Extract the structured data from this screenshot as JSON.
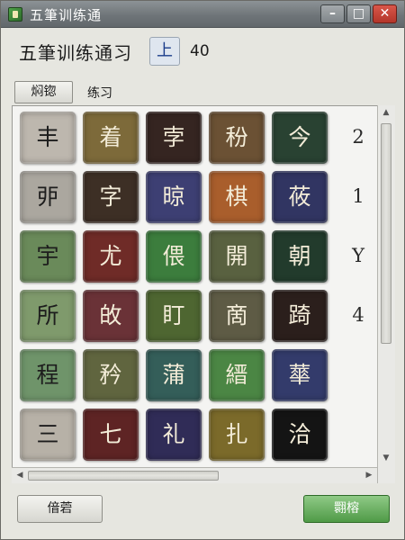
{
  "window": {
    "title": "五筆训练通",
    "controls": {
      "minimize": "–",
      "maximize": "□",
      "close": "✕"
    }
  },
  "header": {
    "app_title": "五筆训练通习",
    "level": "上",
    "score": "40"
  },
  "toolbar": {
    "tab_button": "焖锪",
    "tab_label": "练习"
  },
  "grid": {
    "rows": [
      {
        "tiles": [
          {
            "char": "丰",
            "bg": "#bdb7ae",
            "fg": "#1d1d1d"
          },
          {
            "char": "着",
            "bg": "#7d6a3a",
            "fg": "#f3ecd8"
          },
          {
            "char": "孛",
            "bg": "#352521",
            "fg": "#f3ecd8"
          },
          {
            "char": "秎",
            "bg": "#6b5134",
            "fg": "#f3ecd8"
          },
          {
            "char": "今",
            "bg": "#294232",
            "fg": "#f3ecd8"
          }
        ],
        "side": "2"
      },
      {
        "tiles": [
          {
            "char": "戼",
            "bg": "#aba79f",
            "fg": "#1d1d1d"
          },
          {
            "char": "字",
            "bg": "#3d2f25",
            "fg": "#f3ecd8"
          },
          {
            "char": "晾",
            "bg": "#3d3f73",
            "fg": "#f3ecd8"
          },
          {
            "char": "棋",
            "bg": "#a95e2c",
            "fg": "#f3ecd8"
          },
          {
            "char": "莜",
            "bg": "#313562",
            "fg": "#f3ecd8"
          }
        ],
        "side": "1"
      },
      {
        "tiles": [
          {
            "char": "宇",
            "bg": "#6a8a5a",
            "fg": "#1d1d1d"
          },
          {
            "char": "尤",
            "bg": "#6f2b27",
            "fg": "#f3ecd8"
          },
          {
            "char": "偎",
            "bg": "#3c7d3d",
            "fg": "#f3ecd8"
          },
          {
            "char": "開",
            "bg": "#596140",
            "fg": "#f3ecd8"
          },
          {
            "char": "朝",
            "bg": "#223b2c",
            "fg": "#f3ecd8"
          }
        ],
        "side": "Y"
      },
      {
        "tiles": [
          {
            "char": "所",
            "bg": "#7f9a6c",
            "fg": "#1d1d1d"
          },
          {
            "char": "敀",
            "bg": "#6a3237",
            "fg": "#f3ecd8"
          },
          {
            "char": "盯",
            "bg": "#4e6631",
            "fg": "#f3ecd8"
          },
          {
            "char": "啇",
            "bg": "#5e5b45",
            "fg": "#f3ecd8"
          },
          {
            "char": "踦",
            "bg": "#2b1f1c",
            "fg": "#f3ecd8"
          }
        ],
        "side": "4"
      },
      {
        "tiles": [
          {
            "char": "程",
            "bg": "#6f946a",
            "fg": "#1d1d1d"
          },
          {
            "char": "矜",
            "bg": "#60653f",
            "fg": "#f3ecd8"
          },
          {
            "char": "蒲",
            "bg": "#345e59",
            "fg": "#f3ecd8"
          },
          {
            "char": "縉",
            "bg": "#4b8644",
            "fg": "#f3ecd8"
          },
          {
            "char": "蕐",
            "bg": "#333b6b",
            "fg": "#f3ecd8"
          }
        ],
        "side": ""
      },
      {
        "tiles": [
          {
            "char": "三",
            "bg": "#b7b1a7",
            "fg": "#1d1d1d"
          },
          {
            "char": "七",
            "bg": "#5e2424",
            "fg": "#f3ecd8"
          },
          {
            "char": "礼",
            "bg": "#302c57",
            "fg": "#f3ecd8"
          },
          {
            "char": "扎",
            "bg": "#7b6a2a",
            "fg": "#f3ecd8"
          },
          {
            "char": "洽",
            "bg": "#141414",
            "fg": "#f3ecd8"
          }
        ],
        "side": ""
      }
    ]
  },
  "footer": {
    "left_button": "偣菪",
    "right_button": "翾榕"
  },
  "icons": {
    "scroll_up": "up-arrow-icon",
    "scroll_down": "down-arrow-icon",
    "scroll_left": "left-arrow-icon",
    "scroll_right": "right-arrow-icon"
  }
}
